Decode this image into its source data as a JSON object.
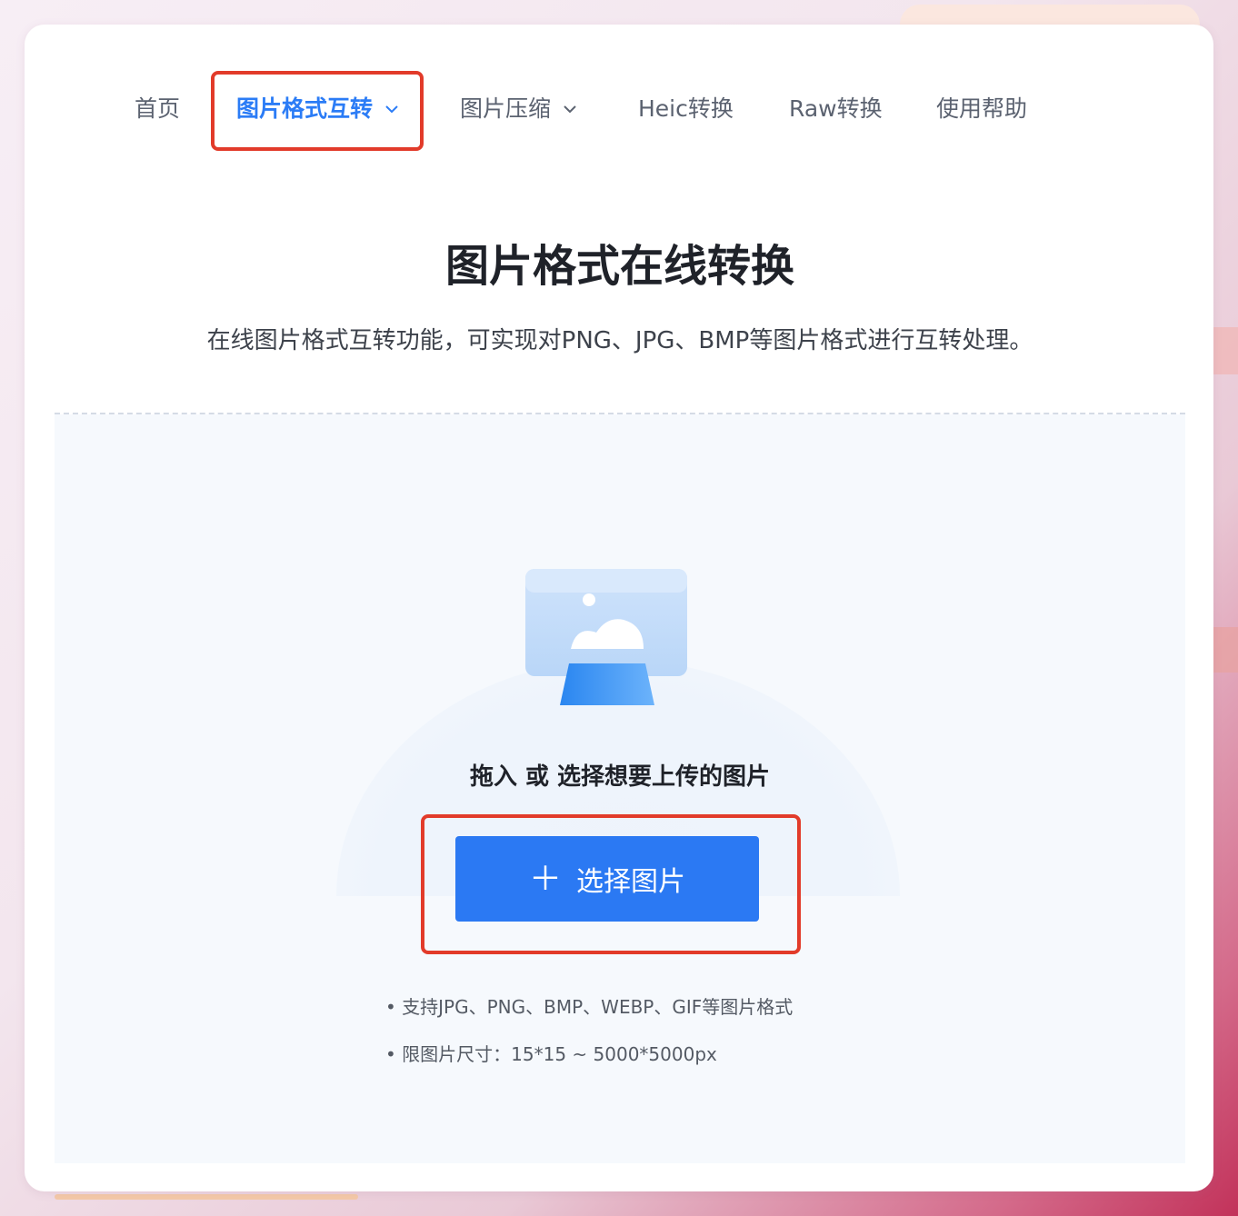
{
  "nav": {
    "items": [
      {
        "label": "首页"
      },
      {
        "label": "图片格式互转",
        "active": true,
        "dropdown": true
      },
      {
        "label": "图片压缩",
        "dropdown": true
      },
      {
        "label": "Heic转换"
      },
      {
        "label": "Raw转换"
      },
      {
        "label": "使用帮助"
      }
    ]
  },
  "hero": {
    "title": "图片格式在线转换",
    "subtitle": "在线图片格式互转功能，可实现对PNG、JPG、BMP等图片格式进行互转处理。"
  },
  "upload": {
    "drop_text": "拖入 或 选择想要上传的图片",
    "button_label": "选择图片",
    "notes": [
      "• 支持JPG、PNG、BMP、WEBP、GIF等图片格式",
      "• 限图片尺寸：15*15 ~ 5000*5000px"
    ]
  },
  "colors": {
    "accent": "#2b79f3",
    "active_nav": "#2b7cf6",
    "highlight": "#e23b2a"
  }
}
